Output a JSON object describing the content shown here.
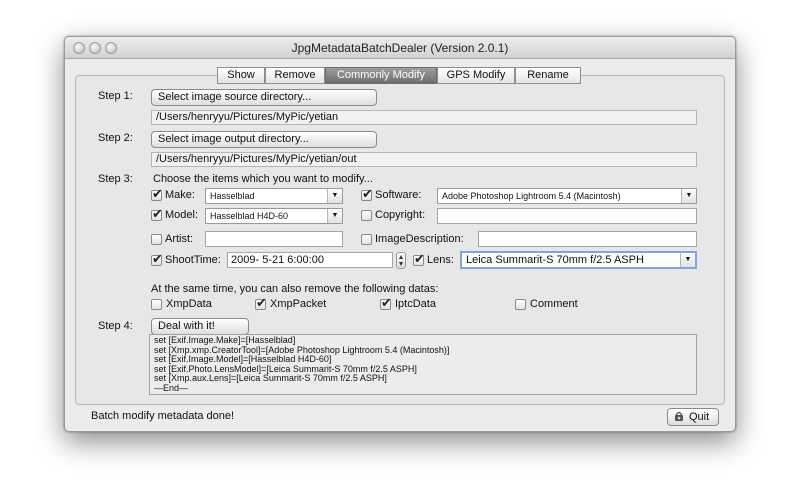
{
  "window": {
    "title": "JpgMetadataBatchDealer (Version 2.0.1)"
  },
  "tabs": [
    {
      "label": "Show"
    },
    {
      "label": "Remove"
    },
    {
      "label": "Commonly Modify"
    },
    {
      "label": "GPS Modify"
    },
    {
      "label": "Rename"
    }
  ],
  "step1": {
    "label": "Step 1:",
    "button": "Select image source directory...",
    "path": "/Users/henryyu/Pictures/MyPic/yetian"
  },
  "step2": {
    "label": "Step 2:",
    "button": "Select image output directory...",
    "path": "/Users/henryyu/Pictures/MyPic/yetian/out"
  },
  "step3": {
    "label": "Step 3:",
    "instruction": "Choose the items which you want to modify...",
    "make": {
      "label": "Make:",
      "value": "Hasselblad",
      "checked": true
    },
    "software": {
      "label": "Software:",
      "value": "Adobe Photoshop Lightroom 5.4 (Macintosh)",
      "checked": true
    },
    "model": {
      "label": "Model:",
      "value": "Hasselblad H4D-60",
      "checked": true
    },
    "copyright": {
      "label": "Copyright:",
      "value": "",
      "checked": false
    },
    "artist": {
      "label": "Artist:",
      "value": "",
      "checked": false
    },
    "image_description": {
      "label": "ImageDescription:",
      "value": "",
      "checked": false
    },
    "shoottime": {
      "label": "ShootTime:",
      "value": "2009- 5-21  6:00:00",
      "checked": true
    },
    "lens": {
      "label": "Lens:",
      "value": "Leica Summarit-S 70mm f/2.5 ASPH",
      "checked": true
    },
    "remove_instruction": "At the same time, you can also remove the following datas:",
    "remove": [
      {
        "label": "XmpData",
        "checked": false
      },
      {
        "label": "XmpPacket",
        "checked": true
      },
      {
        "label": "IptcData",
        "checked": true
      },
      {
        "label": "Comment",
        "checked": false
      }
    ]
  },
  "step4": {
    "label": "Step 4:",
    "button": "Deal with it!",
    "log": [
      "set [Exif.Image.Make]=[Hasselblad]",
      "set [Xmp.xmp.CreatorTool]=[Adobe Photoshop Lightroom 5.4 (Macintosh)]",
      "set [Exif.Image.Model]=[Hasselblad H4D-60]",
      "set [Exif.Photo.LensModel]=[Leica Summarit-S 70mm f/2.5 ASPH]",
      "set [Xmp.aux.Lens]=[Leica Summarit-S 70mm f/2.5 ASPH]",
      "  —End—"
    ]
  },
  "status": {
    "text": "Batch modify metadata done!",
    "quit_label": "Quit"
  },
  "icons": {
    "check": "✔",
    "combo_arrow": "▼",
    "stepper": "stepper-icon",
    "quit": "quit-icon"
  }
}
